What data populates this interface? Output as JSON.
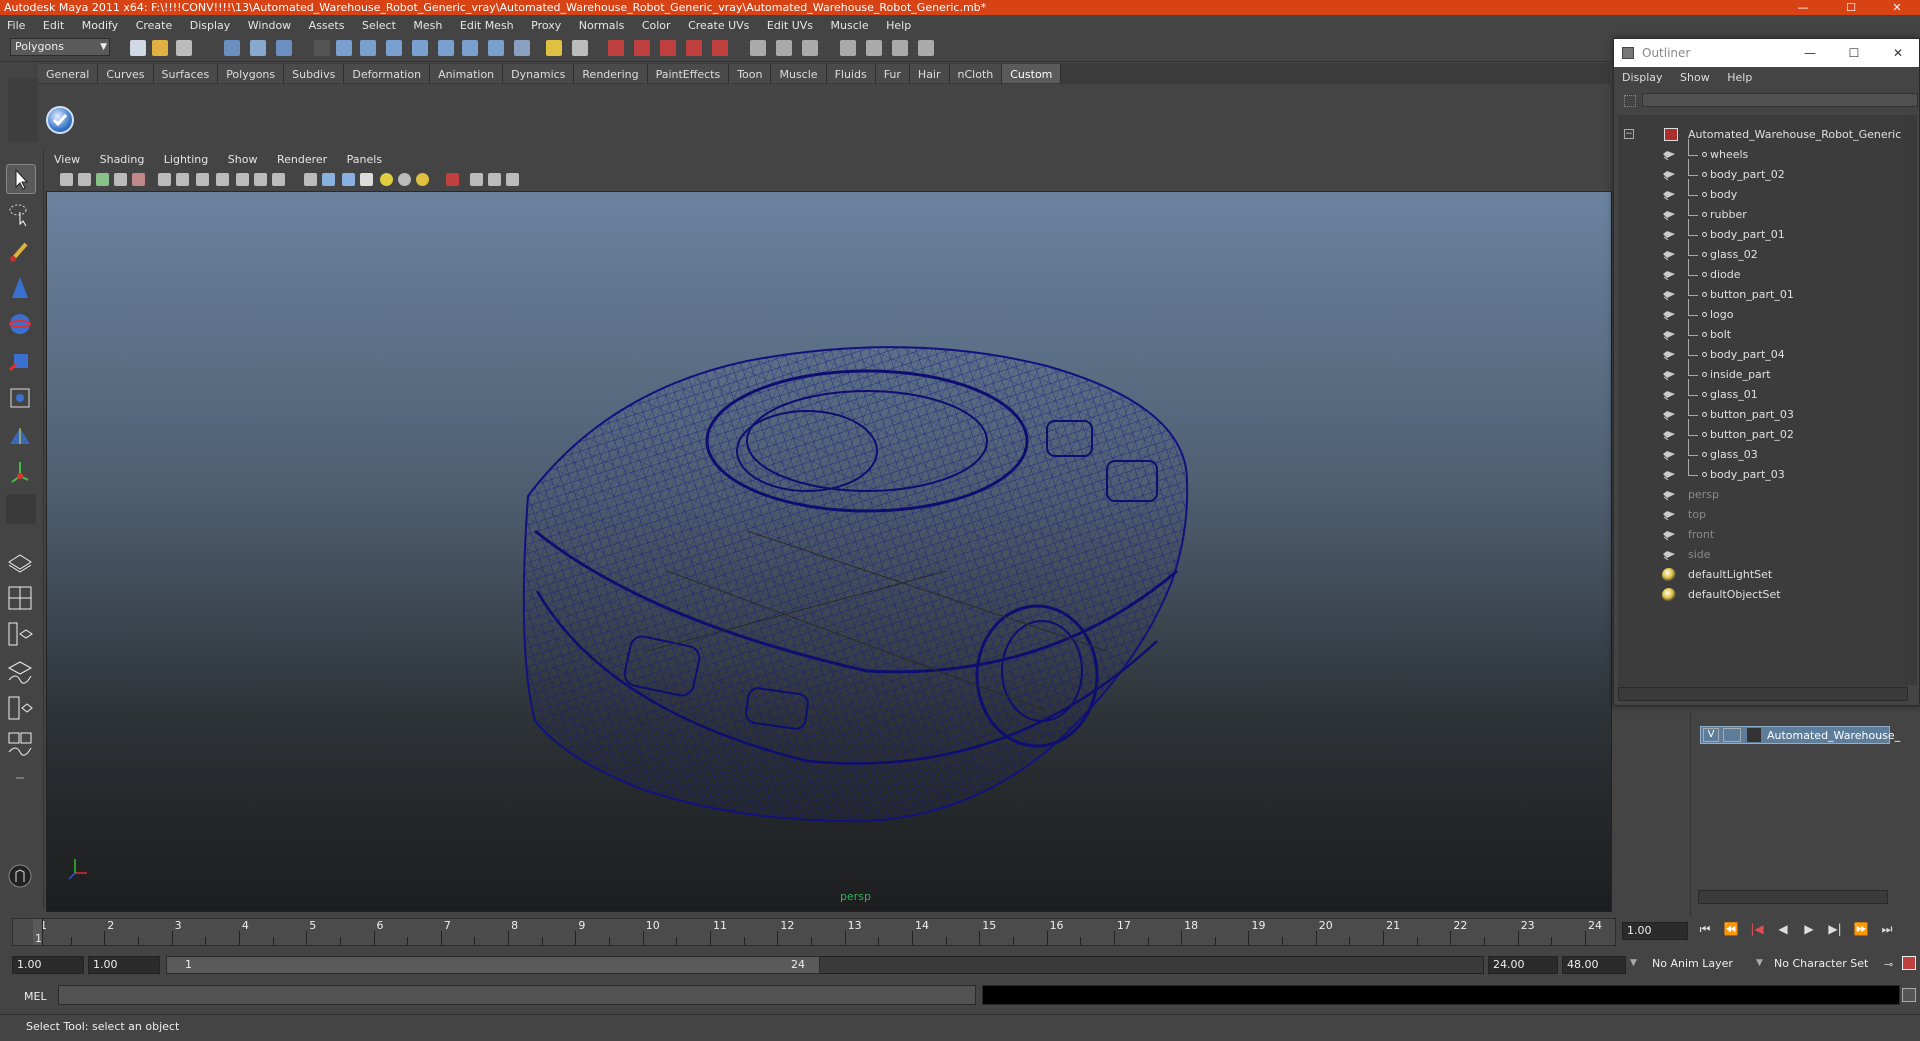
{
  "window": {
    "title": "Autodesk Maya 2011 x64: F:\\!!!!CONV!!!!\\13\\Automated_Warehouse_Robot_Generic_vray\\Automated_Warehouse_Robot_Generic_vray\\Automated_Warehouse_Robot_Generic.mb*",
    "minimize": "—",
    "maximize": "☐",
    "close": "✕"
  },
  "menubar": [
    "File",
    "Edit",
    "Modify",
    "Create",
    "Display",
    "Window",
    "Assets",
    "Select",
    "Mesh",
    "Edit Mesh",
    "Proxy",
    "Normals",
    "Color",
    "Create UVs",
    "Edit UVs",
    "Muscle",
    "Help"
  ],
  "mode_selector": "Polygons",
  "shelf_tabs": [
    {
      "label": "General"
    },
    {
      "label": "Curves"
    },
    {
      "label": "Surfaces"
    },
    {
      "label": "Polygons"
    },
    {
      "label": "Subdivs"
    },
    {
      "label": "Deformation"
    },
    {
      "label": "Animation"
    },
    {
      "label": "Dynamics"
    },
    {
      "label": "Rendering"
    },
    {
      "label": "PaintEffects"
    },
    {
      "label": "Toon"
    },
    {
      "label": "Muscle"
    },
    {
      "label": "Fluids"
    },
    {
      "label": "Fur"
    },
    {
      "label": "Hair"
    },
    {
      "label": "nCloth"
    },
    {
      "label": "Custom",
      "active": true
    }
  ],
  "viewport": {
    "menu": [
      "View",
      "Shading",
      "Lighting",
      "Show",
      "Renderer",
      "Panels"
    ],
    "camera_label": "persp",
    "wire_color": "#1a1a8c"
  },
  "timeline": {
    "ticks": [
      "1",
      "2",
      "3",
      "4",
      "5",
      "6",
      "7",
      "8",
      "9",
      "10",
      "11",
      "12",
      "13",
      "14",
      "15",
      "16",
      "17",
      "18",
      "19",
      "20",
      "21",
      "22",
      "23",
      "24"
    ],
    "current_frame_marker": "1",
    "current_frame": "1.00"
  },
  "range": {
    "start": "1.00",
    "playback_start": "1.00",
    "slider_start": "1",
    "slider_end": "24",
    "playback_end": "24.00",
    "end": "48.00",
    "anim_layer": "No Anim Layer",
    "character_set": "No Character Set"
  },
  "command": {
    "mel_label": "MEL",
    "help": "Select Tool: select an object"
  },
  "layer": {
    "visible": "V",
    "name": "Automated_Warehouse_"
  },
  "outliner": {
    "title": "Outliner",
    "menu": [
      "Display",
      "Show",
      "Help"
    ],
    "root": "Automated_Warehouse_Robot_Generic",
    "children": [
      "wheels",
      "body_part_02",
      "body",
      "rubber",
      "body_part_01",
      "glass_02",
      "diode",
      "button_part_01",
      "logo",
      "bolt",
      "body_part_04",
      "inside_part",
      "glass_01",
      "button_part_03",
      "button_part_02",
      "glass_03",
      "body_part_03"
    ],
    "cameras": [
      "persp",
      "top",
      "front",
      "side"
    ],
    "sets": [
      "defaultLightSet",
      "defaultObjectSet"
    ]
  }
}
